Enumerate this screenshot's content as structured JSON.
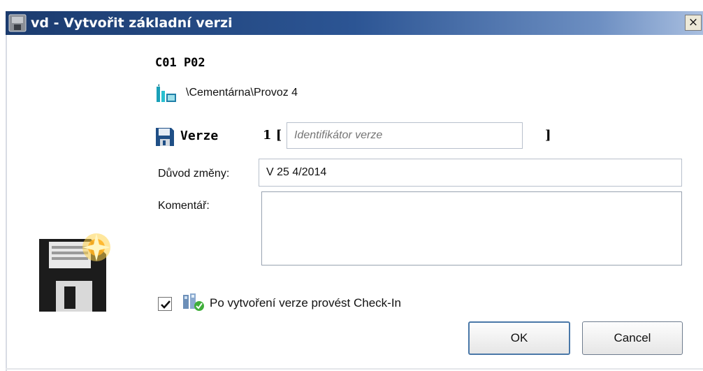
{
  "window": {
    "title": "vd - Vytvořit základní verzi",
    "close_label": "×"
  },
  "header": {
    "heading": "C01 P02",
    "path": "\\Cementárna\\Provoz 4"
  },
  "version": {
    "label": "Verze",
    "number": "1 [",
    "placeholder": "Identifikátor verze",
    "value": "",
    "closing_bracket": "]"
  },
  "reason": {
    "label": "Důvod změny:",
    "value": "V 25 4/2014"
  },
  "comment": {
    "label": "Komentář:",
    "value": ""
  },
  "checkin": {
    "checked": true,
    "label": "Po vytvoření verze provést Check-In"
  },
  "buttons": {
    "ok_label": "OK",
    "cancel_label": "Cancel"
  },
  "icons": {
    "window_icon": "app-icon",
    "path_icon": "plant-icon",
    "version_icon": "floppy-icon",
    "dialog_icon": "floppy-new-icon",
    "checkin_icon": "checkin-icon"
  },
  "colors": {
    "titlebar_start": "#1b3b6e",
    "titlebar_end": "#a9bfe0",
    "ok_border": "#4a78a8"
  }
}
